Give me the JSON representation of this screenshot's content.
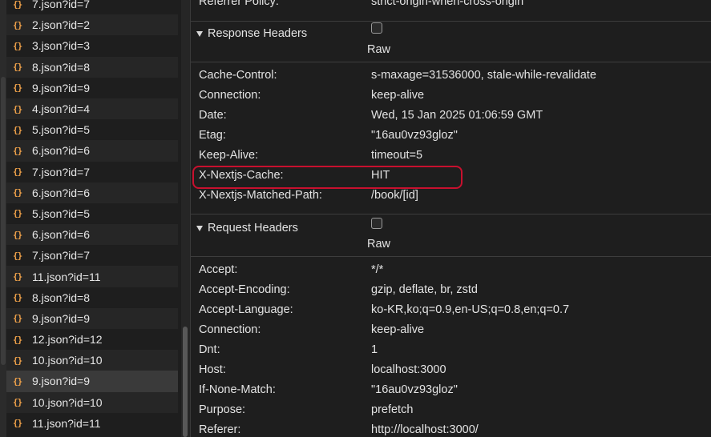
{
  "request_list": [
    {
      "name": "7.json?id=7",
      "icon": "{}"
    },
    {
      "name": "2.json?id=2",
      "icon": "{}"
    },
    {
      "name": "3.json?id=3",
      "icon": "{}"
    },
    {
      "name": "8.json?id=8",
      "icon": "{}"
    },
    {
      "name": "9.json?id=9",
      "icon": "{}"
    },
    {
      "name": "4.json?id=4",
      "icon": "{}"
    },
    {
      "name": "5.json?id=5",
      "icon": "{}"
    },
    {
      "name": "6.json?id=6",
      "icon": "{}"
    },
    {
      "name": "7.json?id=7",
      "icon": "{}"
    },
    {
      "name": "6.json?id=6",
      "icon": "{}"
    },
    {
      "name": "5.json?id=5",
      "icon": "{}"
    },
    {
      "name": "6.json?id=6",
      "icon": "{}"
    },
    {
      "name": "7.json?id=7",
      "icon": "{}"
    },
    {
      "name": "11.json?id=11",
      "icon": "{}"
    },
    {
      "name": "8.json?id=8",
      "icon": "{}"
    },
    {
      "name": "9.json?id=9",
      "icon": "{}"
    },
    {
      "name": "12.json?id=12",
      "icon": "{}"
    },
    {
      "name": "10.json?id=10",
      "icon": "{}"
    },
    {
      "name": "9.json?id=9",
      "icon": "{}",
      "selected": true
    },
    {
      "name": "10.json?id=10",
      "icon": "{}"
    },
    {
      "name": "11.json?id=11",
      "icon": "{}"
    }
  ],
  "top_partial": {
    "key": "Referrer Policy:",
    "value": "strict-origin-when-cross-origin"
  },
  "response_headers": {
    "title": "Response Headers",
    "raw_label": "Raw",
    "raw_checked": false,
    "items": [
      {
        "key": "Cache-Control:",
        "value": "s-maxage=31536000, stale-while-revalidate"
      },
      {
        "key": "Connection:",
        "value": "keep-alive"
      },
      {
        "key": "Date:",
        "value": "Wed, 15 Jan 2025 01:06:59 GMT"
      },
      {
        "key": "Etag:",
        "value": "\"16au0vz93gloz\""
      },
      {
        "key": "Keep-Alive:",
        "value": "timeout=5"
      },
      {
        "key": "X-Nextjs-Cache:",
        "value": "HIT",
        "highlighted": true
      },
      {
        "key": "X-Nextjs-Matched-Path:",
        "value": "/book/[id]"
      }
    ]
  },
  "request_headers": {
    "title": "Request Headers",
    "raw_label": "Raw",
    "raw_checked": false,
    "items": [
      {
        "key": "Accept:",
        "value": "*/*"
      },
      {
        "key": "Accept-Encoding:",
        "value": "gzip, deflate, br, zstd"
      },
      {
        "key": "Accept-Language:",
        "value": "ko-KR,ko;q=0.9,en-US;q=0.8,en;q=0.7"
      },
      {
        "key": "Connection:",
        "value": "keep-alive"
      },
      {
        "key": "Dnt:",
        "value": "1"
      },
      {
        "key": "Host:",
        "value": "localhost:3000"
      },
      {
        "key": "If-None-Match:",
        "value": "\"16au0vz93gloz\""
      },
      {
        "key": "Purpose:",
        "value": "prefetch"
      },
      {
        "key": "Referer:",
        "value": "http://localhost:3000/"
      }
    ]
  },
  "colors": {
    "background": "#1e1e1e",
    "icon": "#f0a24a",
    "highlight_border": "#c8102e",
    "selected_row": "#3a3a3a"
  }
}
